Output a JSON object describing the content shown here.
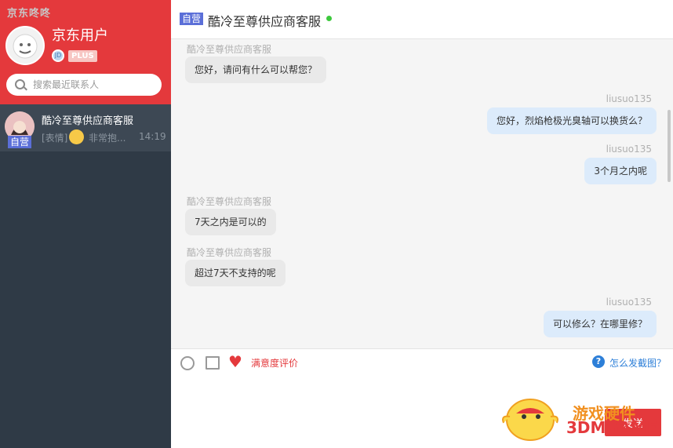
{
  "app": {
    "title": "京东咚咚"
  },
  "user": {
    "name": "京东用户",
    "plus_label": "PLUS"
  },
  "search": {
    "placeholder": "搜索最近联系人"
  },
  "contacts": [
    {
      "tag": "自营",
      "name": "酷冷至尊供应商客服",
      "preview_prefix": "[表情]",
      "preview_text": "非常抱...",
      "time": "14:19"
    }
  ],
  "chat_header": {
    "tag": "自营",
    "title": "酷冷至尊供应商客服",
    "status_color": "#3dc93d"
  },
  "messages": [
    {
      "sender": "酷冷至尊供应商客服",
      "text": "您好，请问有什么可以帮您？",
      "direction": "in"
    },
    {
      "sender": "liusuo135",
      "text": "您好，烈焰枪极光臭轴可以换货么？",
      "direction": "out"
    },
    {
      "sender": "liusuo135",
      "text": "3个月之内呢",
      "direction": "out"
    },
    {
      "sender": "酷冷至尊供应商客服",
      "text": "7天之内是可以的",
      "direction": "in"
    },
    {
      "sender": "酷冷至尊供应商客服",
      "text": "超过7天不支持的呢",
      "direction": "in"
    },
    {
      "sender": "liusuo135",
      "text": "可以修么？在哪里修？",
      "direction": "out"
    }
  ],
  "toolbar": {
    "rating_label": "满意度评价",
    "help_label": "怎么发截图？"
  },
  "input": {
    "send_label": "发送"
  },
  "watermark": {
    "line1": "游戏硬件",
    "line2": "3DMGAME"
  },
  "colors": {
    "brand": "#e4393c",
    "sidebar": "#2f3a46",
    "outgoing_bubble": "#dcebfb",
    "incoming_bubble": "#e9e9e9",
    "link": "#2d7fd8"
  },
  "icons": [
    "search-icon",
    "emoji-icon",
    "image-icon",
    "heart-icon",
    "help-icon"
  ]
}
